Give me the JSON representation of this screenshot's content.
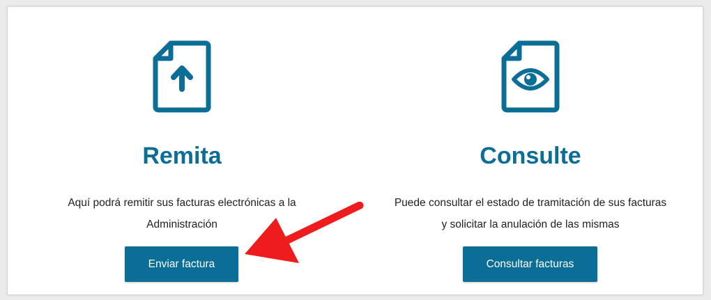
{
  "send": {
    "title": "Remita",
    "description": "Aquí podrá remitir sus facturas electrónicas a la Administración",
    "button_label": "Enviar factura",
    "icon": "document-upload-icon"
  },
  "consult": {
    "title": "Consulte",
    "description": "Puede consultar el estado de tramitación de sus facturas y solicitar la anulación de las mismas",
    "button_label": "Consultar facturas",
    "icon": "document-view-icon"
  },
  "annotation": {
    "icon": "red-arrow-icon",
    "color": "#ee1c1c"
  },
  "colors": {
    "accent": "#0b6e96",
    "text": "#222222",
    "background": "#ebebeb",
    "card": "#ffffff"
  }
}
